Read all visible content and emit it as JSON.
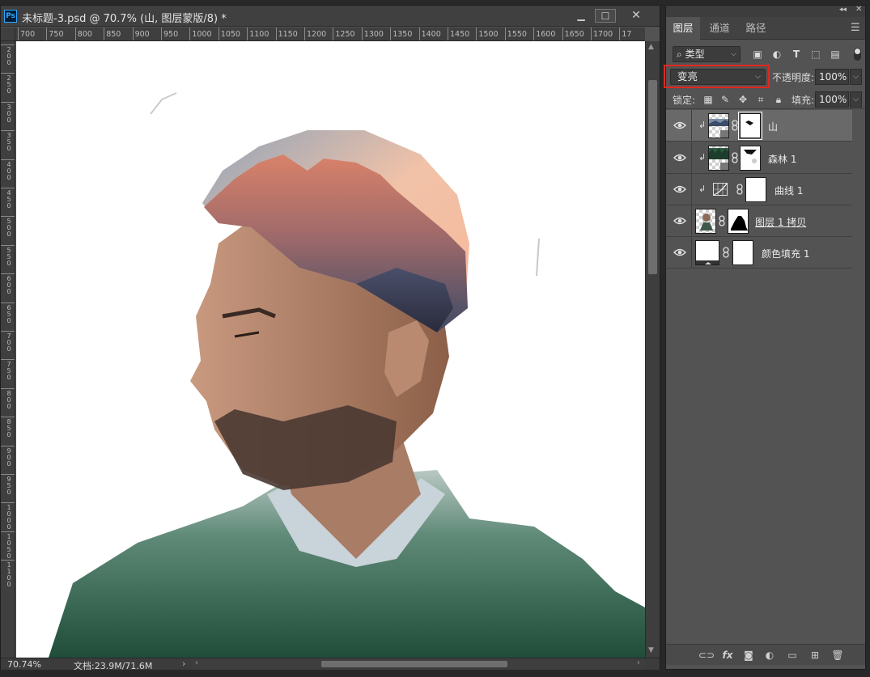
{
  "document": {
    "title": "未标题-3.psd @ 70.7% (山, 图层蒙版/8) *",
    "app_badge": "Ps",
    "minimize_glyph": "▁",
    "maximize_glyph": "☐",
    "close_glyph": "✕"
  },
  "ruler": {
    "horizontal_ticks": [
      "700",
      "750",
      "800",
      "850",
      "900",
      "950",
      "1000",
      "1050",
      "1100",
      "1150",
      "1200",
      "1250",
      "1300",
      "1350",
      "1400",
      "1450",
      "1500",
      "1550",
      "1600",
      "1650",
      "1700",
      "17"
    ],
    "vertical_ticks": [
      "200",
      "250",
      "300",
      "350",
      "400",
      "450",
      "500",
      "550",
      "600",
      "650",
      "700",
      "750",
      "800",
      "850",
      "900",
      "950",
      "1000",
      "1050",
      "1100"
    ]
  },
  "status": {
    "zoom": "70.74%",
    "doc_size": "文档:23.9M/71.6M",
    "arrow": "›"
  },
  "panel": {
    "tabs": [
      {
        "label": "图层",
        "active": true
      },
      {
        "label": "通道",
        "active": false
      },
      {
        "label": "路径",
        "active": false
      }
    ],
    "filter": {
      "label": "类型",
      "search_glyph": "⌕"
    },
    "blend_mode": "变亮",
    "opacity_label": "不透明度:",
    "opacity_value": "100%",
    "lock_label": "锁定:",
    "fill_label": "填充:",
    "fill_value": "100%",
    "layers": [
      {
        "name": "山",
        "clipped": true,
        "selected": true,
        "thumb": "mountain",
        "mask": "mountain-mask"
      },
      {
        "name": "森林 1",
        "clipped": true,
        "selected": false,
        "thumb": "forest",
        "mask": "forest-mask"
      },
      {
        "name": "曲线 1",
        "clipped": true,
        "selected": false,
        "thumb": "curves",
        "mask": "white"
      },
      {
        "name": "图层 1 拷贝",
        "clipped": false,
        "selected": false,
        "thumb": "portrait",
        "mask": "portrait-mask"
      },
      {
        "name": "颜色填充 1",
        "clipped": false,
        "selected": false,
        "thumb": "fill",
        "mask": "white"
      }
    ]
  },
  "colors": {
    "selection_highlight": "#e0271f",
    "panel_bg": "#535353",
    "selected_row": "#696969"
  }
}
